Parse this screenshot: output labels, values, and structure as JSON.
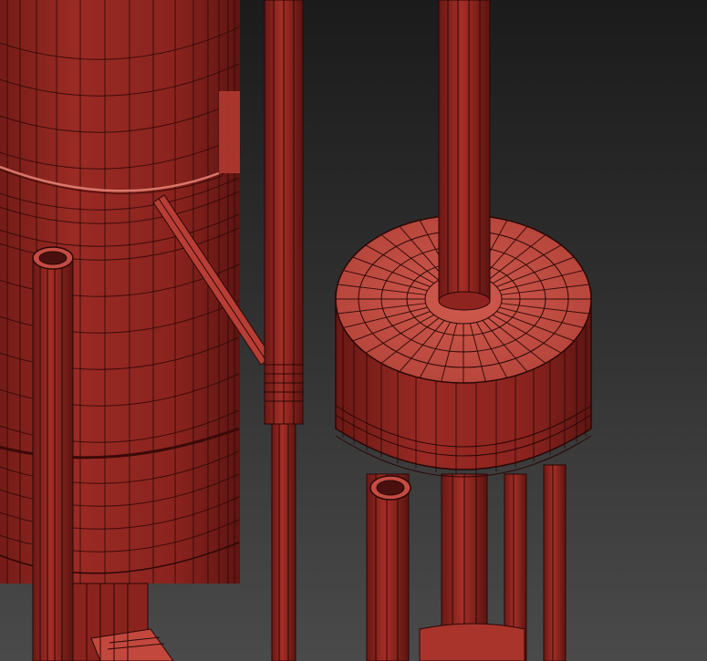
{
  "viewport": {
    "kind": "3d-wireframe-render",
    "colors": {
      "background_top": "#1b1b1b",
      "background_bottom": "#4a4a4a",
      "mesh_face": "#8e2420",
      "mesh_face_light": "#c44c42",
      "mesh_face_dark": "#5e1512",
      "wire": "#2a0706"
    }
  },
  "objects": [
    "large-vessel",
    "vessel-base",
    "support-pipe-left",
    "diagonal-strut",
    "thin-vertical-pipe",
    "drum-tank",
    "drum-top-stack",
    "drum-leg-pipes",
    "open-pipe-end"
  ]
}
